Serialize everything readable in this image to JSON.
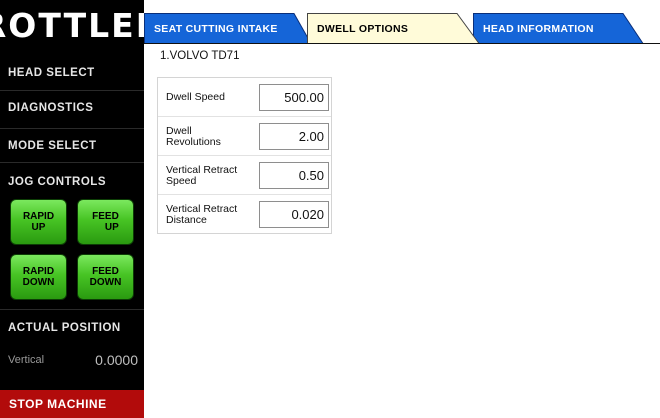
{
  "sidebar": {
    "logo": "ROTTLER",
    "nav": {
      "head_select": "HEAD SELECT",
      "diagnostics": "DIAGNOSTICS",
      "mode_select": "MODE SELECT"
    },
    "jog_controls_label": "JOG CONTROLS",
    "jog": {
      "rapid_up": "RAPID\nUP",
      "feed_up": "FEED\nUP",
      "rapid_down": "RAPID\nDOWN",
      "feed_down": "FEED\nDOWN"
    },
    "actual_position_label": "ACTUAL POSITION",
    "position": {
      "axis": "Vertical",
      "value": "0.0000"
    },
    "stop_button": "STOP MACHINE"
  },
  "tabs": [
    {
      "label": "SEAT CUTTING INTAKE",
      "active": false
    },
    {
      "label": "DWELL OPTIONS",
      "active": true
    },
    {
      "label": "HEAD INFORMATION",
      "active": false
    }
  ],
  "main": {
    "head_title": "1.VOLVO TD71",
    "params": [
      {
        "label": "Dwell Speed",
        "value": "500.00"
      },
      {
        "label": "Dwell\nRevolutions",
        "value": "2.00"
      },
      {
        "label": "Vertical Retract\nSpeed",
        "value": "0.50"
      },
      {
        "label": "Vertical Retract\nDistance",
        "value": "0.020"
      }
    ]
  },
  "colors": {
    "sidebar_bg": "#000000",
    "tab_inactive": "#1565d8",
    "tab_active": "#fffbd9",
    "jog_green": "#47c424",
    "stop_red": "#b20b0b"
  }
}
